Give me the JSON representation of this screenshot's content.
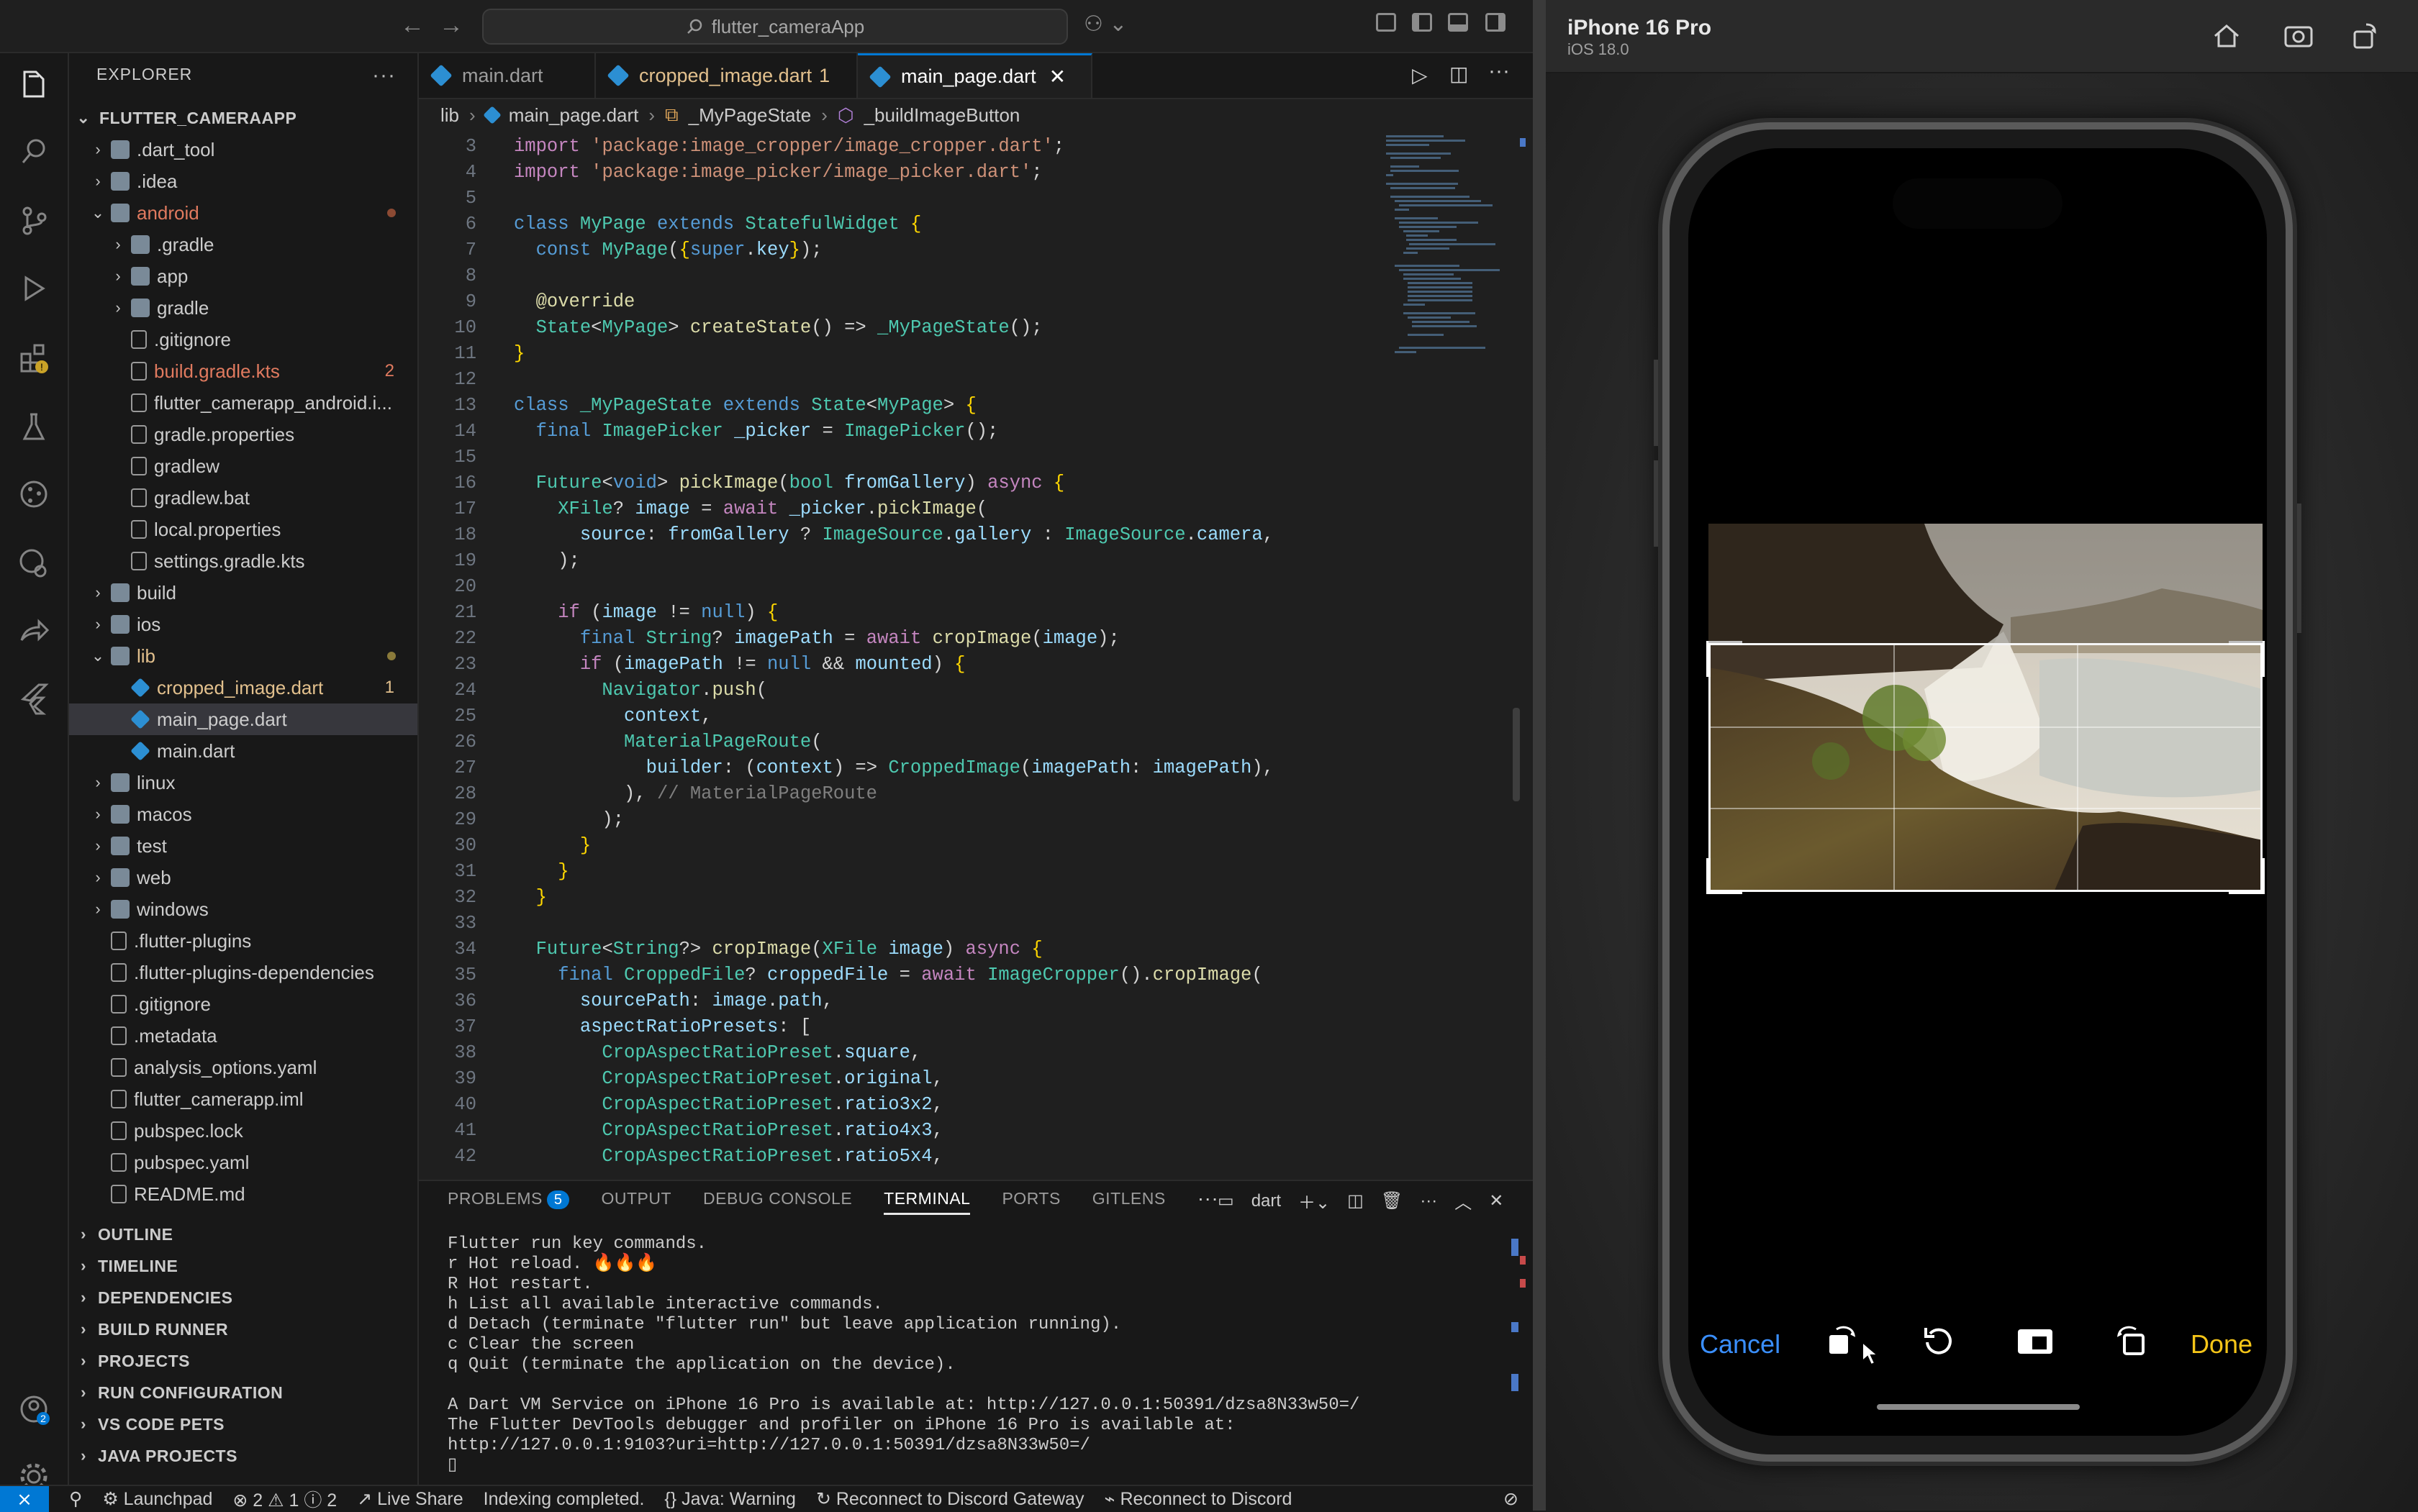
{
  "window": {
    "search_text": "flutter_cameraApp"
  },
  "explorer": {
    "title": "EXPLORER",
    "project": "FLUTTER_CAMERAAPP",
    "items": [
      {
        "label": ".dart_tool",
        "kind": "folder",
        "indent": 1,
        "badge": "",
        "color": "#cccccc"
      },
      {
        "label": ".idea",
        "kind": "folder",
        "indent": 1,
        "badge": "",
        "color": "#cccccc"
      },
      {
        "label": "android",
        "kind": "folder-open",
        "indent": 1,
        "badge": "",
        "color": "#e07a5f"
      },
      {
        "label": ".gradle",
        "kind": "folder",
        "indent": 2,
        "badge": "",
        "color": "#cccccc"
      },
      {
        "label": "app",
        "kind": "folder",
        "indent": 2,
        "badge": "",
        "color": "#cccccc"
      },
      {
        "label": "gradle",
        "kind": "folder",
        "indent": 2,
        "badge": "",
        "color": "#cccccc"
      },
      {
        "label": ".gitignore",
        "kind": "file",
        "indent": 2,
        "badge": "",
        "color": "#cccccc"
      },
      {
        "label": "build.gradle.kts",
        "kind": "file",
        "indent": 2,
        "badge": "2",
        "color": "#e07a5f"
      },
      {
        "label": "flutter_camerapp_android.i...",
        "kind": "file",
        "indent": 2,
        "badge": "",
        "color": "#cccccc"
      },
      {
        "label": "gradle.properties",
        "kind": "file",
        "indent": 2,
        "badge": "",
        "color": "#cccccc"
      },
      {
        "label": "gradlew",
        "kind": "file",
        "indent": 2,
        "badge": "",
        "color": "#cccccc"
      },
      {
        "label": "gradlew.bat",
        "kind": "file",
        "indent": 2,
        "badge": "",
        "color": "#cccccc"
      },
      {
        "label": "local.properties",
        "kind": "file",
        "indent": 2,
        "badge": "",
        "color": "#cccccc"
      },
      {
        "label": "settings.gradle.kts",
        "kind": "file",
        "indent": 2,
        "badge": "",
        "color": "#cccccc"
      },
      {
        "label": "build",
        "kind": "folder",
        "indent": 1,
        "badge": "",
        "color": "#cccccc"
      },
      {
        "label": "ios",
        "kind": "folder",
        "indent": 1,
        "badge": "",
        "color": "#cccccc"
      },
      {
        "label": "lib",
        "kind": "folder-open",
        "indent": 1,
        "badge": "",
        "color": "#e2c08d"
      },
      {
        "label": "cropped_image.dart",
        "kind": "dart",
        "indent": 2,
        "badge": "1",
        "color": "#e2c08d"
      },
      {
        "label": "main_page.dart",
        "kind": "dart",
        "indent": 2,
        "badge": "",
        "color": "#cccccc"
      },
      {
        "label": "main.dart",
        "kind": "dart",
        "indent": 2,
        "badge": "",
        "color": "#cccccc"
      },
      {
        "label": "linux",
        "kind": "folder",
        "indent": 1,
        "badge": "",
        "color": "#cccccc"
      },
      {
        "label": "macos",
        "kind": "folder",
        "indent": 1,
        "badge": "",
        "color": "#cccccc"
      },
      {
        "label": "test",
        "kind": "folder",
        "indent": 1,
        "badge": "",
        "color": "#cccccc"
      },
      {
        "label": "web",
        "kind": "folder",
        "indent": 1,
        "badge": "",
        "color": "#cccccc"
      },
      {
        "label": "windows",
        "kind": "folder",
        "indent": 1,
        "badge": "",
        "color": "#cccccc"
      },
      {
        "label": ".flutter-plugins",
        "kind": "file",
        "indent": 1,
        "badge": "",
        "color": "#cccccc"
      },
      {
        "label": ".flutter-plugins-dependencies",
        "kind": "file",
        "indent": 1,
        "badge": "",
        "color": "#cccccc"
      },
      {
        "label": ".gitignore",
        "kind": "file",
        "indent": 1,
        "badge": "",
        "color": "#cccccc"
      },
      {
        "label": ".metadata",
        "kind": "file",
        "indent": 1,
        "badge": "",
        "color": "#cccccc"
      },
      {
        "label": "analysis_options.yaml",
        "kind": "file",
        "indent": 1,
        "badge": "",
        "color": "#cccccc"
      },
      {
        "label": "flutter_camerapp.iml",
        "kind": "file",
        "indent": 1,
        "badge": "",
        "color": "#cccccc"
      },
      {
        "label": "pubspec.lock",
        "kind": "file",
        "indent": 1,
        "badge": "",
        "color": "#cccccc"
      },
      {
        "label": "pubspec.yaml",
        "kind": "file",
        "indent": 1,
        "badge": "",
        "color": "#cccccc"
      },
      {
        "label": "README.md",
        "kind": "file",
        "indent": 1,
        "badge": "",
        "color": "#cccccc"
      }
    ],
    "sections": [
      "OUTLINE",
      "TIMELINE",
      "DEPENDENCIES",
      "BUILD RUNNER",
      "PROJECTS",
      "RUN CONFIGURATION",
      "VS CODE PETS",
      "JAVA PROJECTS"
    ]
  },
  "tabs": [
    {
      "label": "main.dart",
      "badge": ""
    },
    {
      "label": "cropped_image.dart",
      "badge": "1"
    },
    {
      "label": "main_page.dart",
      "badge": ""
    }
  ],
  "breadcrumbs": [
    "lib",
    "main_page.dart",
    "_MyPageState",
    "_buildImageButton"
  ],
  "code_lines": [
    {
      "n": "3",
      "html": "<span class='kw'>import</span> <span class='str'>'package:image_cropper/image_cropper.dart'</span>;"
    },
    {
      "n": "4",
      "html": "<span class='kw'>import</span> <span class='str'>'package:image_picker/image_picker.dart'</span>;"
    },
    {
      "n": "5",
      "html": ""
    },
    {
      "n": "6",
      "html": "<span class='bl'>class</span> <span class='ty'>MyPage</span> <span class='bl'>extends</span> <span class='ty'>StatefulWidget</span> <span class='pu'>{</span>"
    },
    {
      "n": "7",
      "html": "  <span class='bl'>const</span> <span class='ty'>MyPage</span>(<span class='pu'>{</span><span class='bl'>super</span>.<span class='nm'>key</span><span class='pu'>}</span>);"
    },
    {
      "n": "8",
      "html": ""
    },
    {
      "n": "9",
      "html": "  <span class='an'>@override</span>"
    },
    {
      "n": "10",
      "html": "  <span class='ty'>State</span>&lt;<span class='ty'>MyPage</span>&gt; <span class='fn'>createState</span>() =&gt; <span class='ty'>_MyPageState</span>();"
    },
    {
      "n": "11",
      "html": "<span class='pu'>}</span>"
    },
    {
      "n": "12",
      "html": ""
    },
    {
      "n": "13",
      "html": "<span class='bl'>class</span> <span class='ty'>_MyPageState</span> <span class='bl'>extends</span> <span class='ty'>State</span>&lt;<span class='ty'>MyPage</span>&gt; <span class='pu'>{</span>"
    },
    {
      "n": "14",
      "html": "  <span class='bl'>final</span> <span class='ty'>ImagePicker</span> <span class='nm'>_picker</span> = <span class='ty'>ImagePicker</span>();"
    },
    {
      "n": "15",
      "html": ""
    },
    {
      "n": "16",
      "html": "  <span class='ty'>Future</span>&lt;<span class='bl'>void</span>&gt; <span class='fn'>pickImage</span>(<span class='ty'>bool</span> <span class='nm'>fromGallery</span>) <span class='kw'>async</span> <span class='pu'>{</span>"
    },
    {
      "n": "17",
      "html": "    <span class='ty'>XFile</span>? <span class='nm'>image</span> = <span class='kw'>await</span> <span class='nm'>_picker</span>.<span class='fn'>pickImage</span>("
    },
    {
      "n": "18",
      "html": "      <span class='nm'>source</span>: <span class='nm'>fromGallery</span> ? <span class='ty'>ImageSource</span>.<span class='nm'>gallery</span> : <span class='ty'>ImageSource</span>.<span class='nm'>camera</span>,"
    },
    {
      "n": "19",
      "html": "    );"
    },
    {
      "n": "20",
      "html": ""
    },
    {
      "n": "21",
      "html": "    <span class='kw'>if</span> (<span class='nm'>image</span> != <span class='bl'>null</span>) <span class='pu'>{</span>"
    },
    {
      "n": "22",
      "html": "      <span class='bl'>final</span> <span class='ty'>String</span>? <span class='nm'>imagePath</span> = <span class='kw'>await</span> <span class='fn'>cropImage</span>(<span class='nm'>image</span>);"
    },
    {
      "n": "23",
      "html": "      <span class='kw'>if</span> (<span class='nm'>imagePath</span> != <span class='bl'>null</span> &amp;&amp; <span class='nm'>mounted</span>) <span class='pu'>{</span>"
    },
    {
      "n": "24",
      "html": "        <span class='ty'>Navigator</span>.<span class='fn'>push</span>("
    },
    {
      "n": "25",
      "html": "          <span class='nm'>context</span>,"
    },
    {
      "n": "26",
      "html": "          <span class='ty'>MaterialPageRoute</span>("
    },
    {
      "n": "27",
      "html": "            <span class='nm'>builder</span>: (<span class='nm'>context</span>) =&gt; <span class='ty'>CroppedImage</span>(<span class='nm'>imagePath</span>: <span class='nm'>imagePath</span>),"
    },
    {
      "n": "28",
      "html": "          ), <span class='cmt'>// MaterialPageRoute</span>"
    },
    {
      "n": "29",
      "html": "        );"
    },
    {
      "n": "30",
      "html": "      <span class='pu'>}</span>"
    },
    {
      "n": "31",
      "html": "    <span class='pu'>}</span>"
    },
    {
      "n": "32",
      "html": "  <span class='pu'>}</span>"
    },
    {
      "n": "33",
      "html": ""
    },
    {
      "n": "34",
      "html": "  <span class='ty'>Future</span>&lt;<span class='ty'>String</span>?&gt; <span class='fn'>cropImage</span>(<span class='ty'>XFile</span> <span class='nm'>image</span>) <span class='kw'>async</span> <span class='pu'>{</span>"
    },
    {
      "n": "35",
      "html": "    <span class='bl'>final</span> <span class='ty'>CroppedFile</span>? <span class='nm'>croppedFile</span> = <span class='kw'>await</span> <span class='ty'>ImageCropper</span>().<span class='fn'>cropImage</span>("
    },
    {
      "n": "36",
      "html": "      <span class='nm'>sourcePath</span>: <span class='nm'>image</span>.<span class='nm'>path</span>,"
    },
    {
      "n": "37",
      "html": "      <span class='nm'>aspectRatioPresets</span>: ["
    },
    {
      "n": "38",
      "html": "        <span class='ty'>CropAspectRatioPreset</span>.<span class='nm'>square</span>,"
    },
    {
      "n": "39",
      "html": "        <span class='ty'>CropAspectRatioPreset</span>.<span class='nm'>original</span>,"
    },
    {
      "n": "40",
      "html": "        <span class='ty'>CropAspectRatioPreset</span>.<span class='nm'>ratio3x2</span>,"
    },
    {
      "n": "41",
      "html": "        <span class='ty'>CropAspectRatioPreset</span>.<span class='nm'>ratio4x3</span>,"
    },
    {
      "n": "42",
      "html": "        <span class='ty'>CropAspectRatioPreset</span>.<span class='nm'>ratio5x4</span>,"
    }
  ],
  "panel": {
    "tabs": [
      "PROBLEMS",
      "OUTPUT",
      "DEBUG CONSOLE",
      "TERMINAL",
      "PORTS",
      "GITLENS"
    ],
    "problems_count": "5",
    "terminal_name": "dart",
    "terminal_lines": [
      "Flutter run key commands.",
      "r Hot reload. 🔥🔥🔥",
      "R Hot restart.",
      "h List all available interactive commands.",
      "d Detach (terminate \"flutter run\" but leave application running).",
      "c Clear the screen",
      "q Quit (terminate the application on the device).",
      "",
      "A Dart VM Service on iPhone 16 Pro is available at: http://127.0.0.1:50391/dzsa8N33w50=/",
      "The Flutter DevTools debugger and profiler on iPhone 16 Pro is available at:",
      "http://127.0.0.1:9103?uri=http://127.0.0.1:50391/dzsa8N33w50=/",
      "▯"
    ]
  },
  "statusbar": {
    "launchpad": "Launchpad",
    "problems": "⊗ 2 ⚠ 1 ⓘ 2",
    "liveshare": "Live Share",
    "indexing": "Indexing completed.",
    "java": "{} Java: Warning",
    "discord_gateway": "Reconnect to Discord Gateway",
    "discord": "Reconnect to Discord"
  },
  "simulator": {
    "device": "iPhone 16 Pro",
    "os": "iOS 18.0",
    "cancel": "Cancel",
    "done": "Done"
  },
  "colors": {
    "accent": "#0078d4",
    "cancel": "#3a8fff",
    "done": "#f5c518"
  }
}
